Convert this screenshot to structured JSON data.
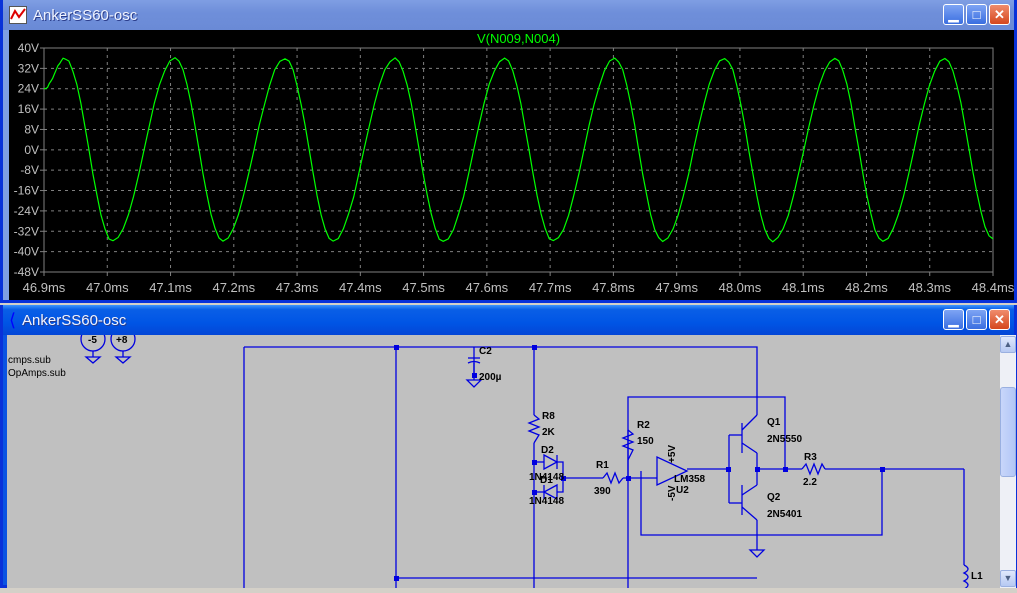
{
  "plot_window": {
    "title": "AnkerSS60-osc",
    "icon": "waveform-icon",
    "buttons": [
      "minimize",
      "maximize",
      "close"
    ]
  },
  "schematic_window": {
    "title": "AnkerSS60-osc",
    "icon": "schematic-icon",
    "buttons": [
      "minimize",
      "maximize",
      "close"
    ]
  },
  "chart_data": {
    "type": "line",
    "title": "V(N009,N004)",
    "xlabel": "",
    "ylabel": "",
    "xlim": [
      46.9,
      48.4
    ],
    "ylim": [
      -48,
      40
    ],
    "x_ticks": [
      "46.9ms",
      "47.0ms",
      "47.1ms",
      "47.2ms",
      "47.3ms",
      "47.4ms",
      "47.5ms",
      "47.6ms",
      "47.7ms",
      "47.8ms",
      "47.9ms",
      "48.0ms",
      "48.1ms",
      "48.2ms",
      "48.3ms",
      "48.4ms"
    ],
    "y_ticks": [
      "40V",
      "32V",
      "24V",
      "16V",
      "8V",
      "0V",
      "-8V",
      "-16V",
      "-24V",
      "-32V",
      "-40V",
      "-48V"
    ],
    "grid": true,
    "series_color": "#00ff00",
    "extrema": {
      "t_ms": [
        46.9,
        46.933,
        47.009,
        47.107,
        47.183,
        47.281,
        47.357,
        47.455,
        47.531,
        47.628,
        47.705,
        47.802,
        47.878,
        47.976,
        48.052,
        48.15,
        48.226,
        48.324,
        48.4
      ],
      "v": [
        24,
        36,
        -36,
        36,
        -36,
        36,
        -36,
        36,
        -36,
        36,
        -36,
        36,
        -36,
        36,
        -36,
        36,
        -36,
        36,
        -35
      ]
    }
  },
  "schematic": {
    "directives": [
      "cmps.sub",
      "OpAmps.sub"
    ],
    "sources": [
      "-5",
      "+8"
    ],
    "components": {
      "c2": {
        "name": "C2",
        "value": "200µ"
      },
      "r8": {
        "name": "R8",
        "value": "2K"
      },
      "d2": {
        "name": "D2",
        "value": "1N4148"
      },
      "d1": {
        "name": "D1",
        "value": "1N4148"
      },
      "r1": {
        "name": "R1",
        "value": "390"
      },
      "r2": {
        "name": "R2",
        "value": "150"
      },
      "u2": {
        "name": "U2",
        "value": "LM358",
        "vpos": "+5V",
        "vneg": "-5V"
      },
      "q1": {
        "name": "Q1",
        "value": "2N5550"
      },
      "q2": {
        "name": "Q2",
        "value": "2N5401"
      },
      "r3": {
        "name": "R3",
        "value": "2.2"
      },
      "l1": {
        "name": "L1"
      }
    },
    "wire_color": "#0000e0"
  }
}
